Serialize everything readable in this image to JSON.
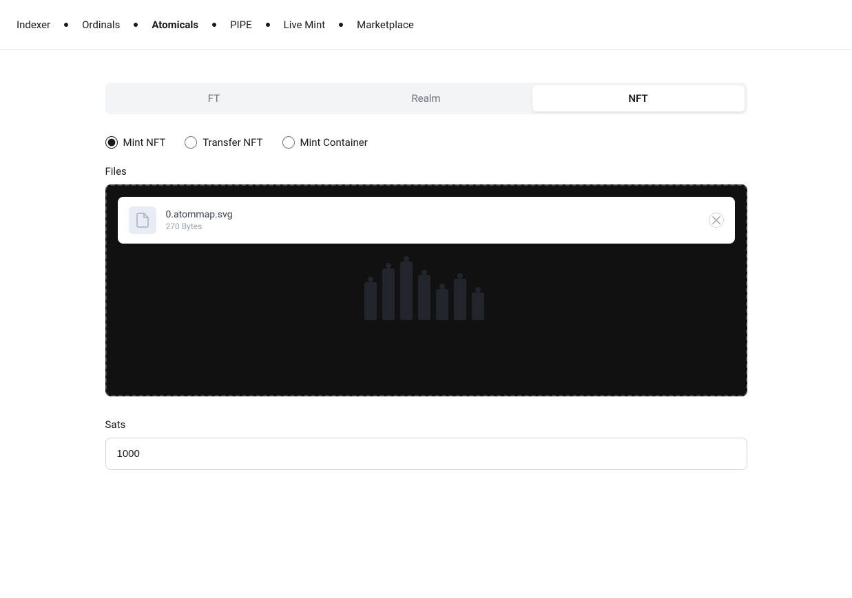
{
  "nav": {
    "items": [
      {
        "label": "Indexer",
        "active": false
      },
      {
        "label": "Ordinals",
        "active": false
      },
      {
        "label": "Atomicals",
        "active": true
      },
      {
        "label": "PIPE",
        "active": false
      },
      {
        "label": "Live Mint",
        "active": false
      },
      {
        "label": "Marketplace",
        "active": false
      }
    ]
  },
  "tabs": [
    {
      "label": "FT",
      "active": false
    },
    {
      "label": "Realm",
      "active": false
    },
    {
      "label": "NFT",
      "active": true
    }
  ],
  "radio_options": [
    {
      "label": "Mint NFT",
      "value": "mint-nft",
      "checked": true
    },
    {
      "label": "Transfer NFT",
      "value": "transfer-nft",
      "checked": false
    },
    {
      "label": "Mint Container",
      "value": "mint-container",
      "checked": false
    }
  ],
  "files_label": "Files",
  "file": {
    "name": "0.atommap.svg",
    "size": "270 Bytes"
  },
  "sats_label": "Sats",
  "sats_value": "1000"
}
